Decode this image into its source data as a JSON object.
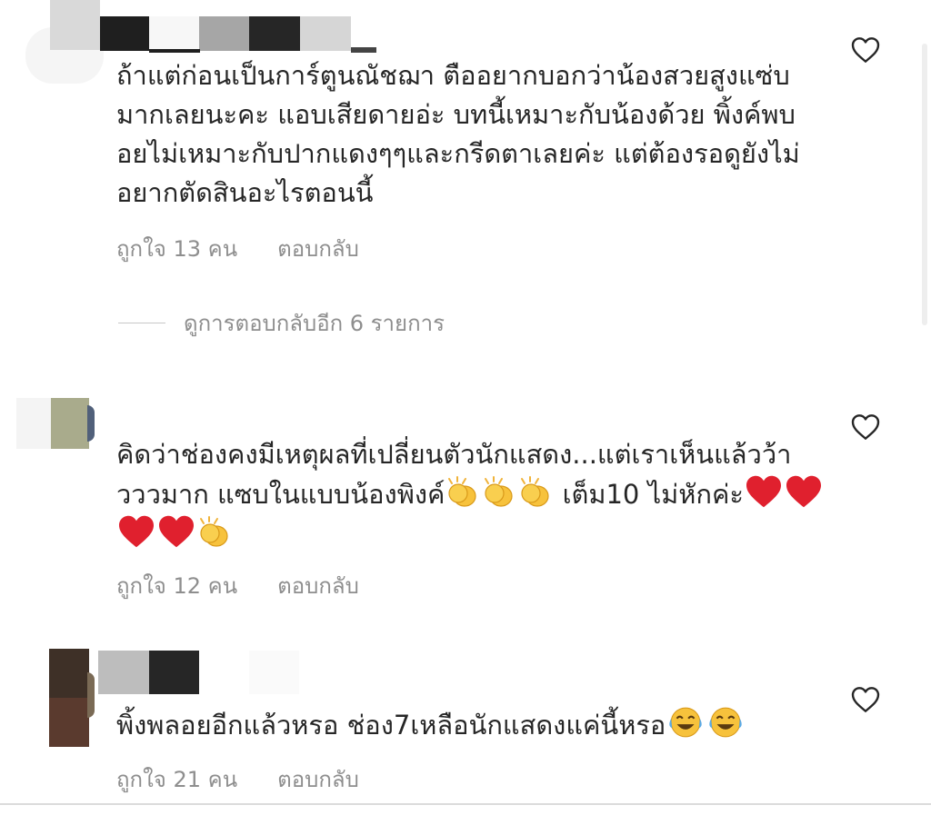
{
  "comments": [
    {
      "text": "ถ้าแต่ก่อนเป็นการ์ตูนณัชฌา ตืออยากบอกว่าน้องสวยสูงแซ่บมากเลยนะคะ แอบเสียดายอ่ะ บทนี้เหมาะกับน้องด้วย พิ้งค์พบอยไม่เหมาะกับปากแดงๆๆและกรีดตาเลยค่ะ แต่ต้องรอดูยังไม่อยากตัดสินอะไรตอนนี้",
      "likes": "ถูกใจ 13 คน",
      "reply": "ตอบกลับ",
      "view_replies": "ดูการตอบกลับอีก 6 รายการ"
    },
    {
      "text": "คิดว่าช่องคงมีเหตุผลที่เปลี่ยนตัวนักแสดง...แต่เราเห็นแล้วว้าวววมาก แซบในแบบน้องพิงค์",
      "text_after_claps": " เต็ม10 ไม่หักค่ะ",
      "emoji_claps": "clapping-hands",
      "emoji_hearts": "red-heart",
      "likes": "ถูกใจ 12 คน",
      "reply": "ตอบกลับ"
    },
    {
      "text": "พิ้งพลอยอีกแล้วหรอ ช่อง7เหลือนักแสดงแค่นี้หรอ",
      "emoji_laugh": "face-with-tears-of-joy",
      "likes": "ถูกใจ 21 คน",
      "reply": "ตอบกลับ"
    }
  ],
  "colors": {
    "text": "#262626",
    "meta": "#8e8e8e",
    "divider": "#dbdbdb",
    "heart_stroke": "#262626",
    "emoji_heart": "#e0202e",
    "emoji_yellow": "#f7c23c"
  }
}
